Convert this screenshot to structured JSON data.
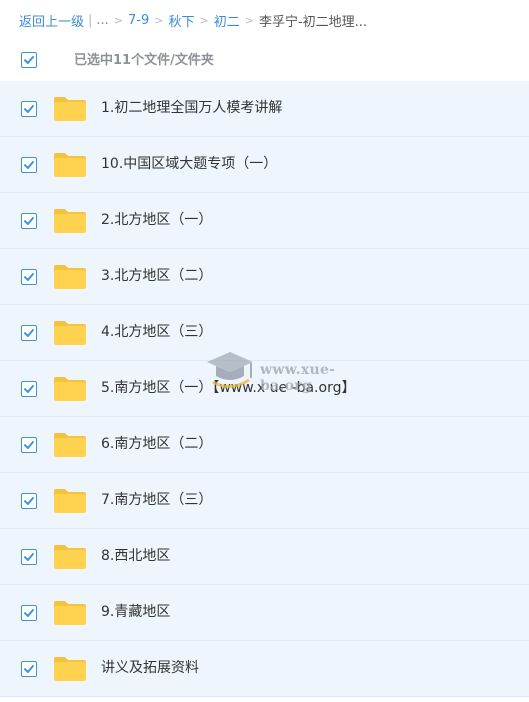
{
  "breadcrumb": {
    "back_label": "返回上一级",
    "bar": "|",
    "ellipsis": "...",
    "separator": ">",
    "items": [
      "7-9",
      "秋下",
      "初二"
    ],
    "current": "李孚宁-初二地理..."
  },
  "selection": {
    "summary": "已选中11个文件/文件夹",
    "all_checked": true
  },
  "files": [
    {
      "name": "1.初二地理全国万人模考讲解",
      "checked": true,
      "type": "folder"
    },
    {
      "name": "10.中国区域大题专项（一）",
      "checked": true,
      "type": "folder"
    },
    {
      "name": "2.北方地区（一）",
      "checked": true,
      "type": "folder"
    },
    {
      "name": "3.北方地区（二）",
      "checked": true,
      "type": "folder"
    },
    {
      "name": "4.北方地区（三）",
      "checked": true,
      "type": "folder"
    },
    {
      "name": "5.南方地区（一）【www.x ue -ba.org】",
      "checked": true,
      "type": "folder"
    },
    {
      "name": "6.南方地区（二）",
      "checked": true,
      "type": "folder"
    },
    {
      "name": "7.南方地区（三）",
      "checked": true,
      "type": "folder"
    },
    {
      "name": "8.西北地区",
      "checked": true,
      "type": "folder"
    },
    {
      "name": "9.青藏地区",
      "checked": true,
      "type": "folder"
    },
    {
      "name": "讲义及拓展资料",
      "checked": true,
      "type": "folder"
    }
  ],
  "watermark": {
    "text": "www.xue-ba.org",
    "icon": "graduation-cap-icon"
  },
  "colors": {
    "link": "#3b8cd6",
    "row_bg": "#eef5fc",
    "checkbox": "#3d94d9",
    "folder": "#ffd34f"
  }
}
